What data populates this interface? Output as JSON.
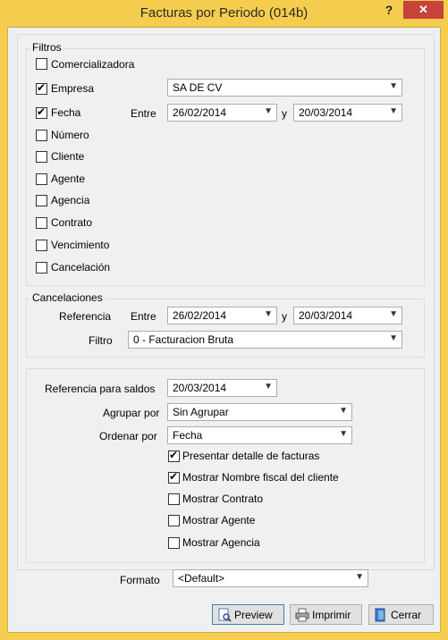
{
  "window": {
    "title": "Facturas por Periodo (014b)",
    "help_glyph": "?",
    "close_glyph": "✕"
  },
  "filtros": {
    "legend": "Filtros",
    "items": [
      {
        "label": "Comercializadora",
        "checked": false
      },
      {
        "label": "Empresa",
        "checked": true
      },
      {
        "label": "Fecha",
        "checked": true
      },
      {
        "label": "Número",
        "checked": false
      },
      {
        "label": "Cliente",
        "checked": false
      },
      {
        "label": "Agente",
        "checked": false
      },
      {
        "label": "Agencia",
        "checked": false
      },
      {
        "label": "Contrato",
        "checked": false
      },
      {
        "label": "Vencimiento",
        "checked": false
      },
      {
        "label": "Cancelación",
        "checked": false
      }
    ],
    "empresa_value": "SA DE CV",
    "entre_label": "Entre",
    "y_label": "y",
    "fecha_desde": "26/02/2014",
    "fecha_hasta": "20/03/2014"
  },
  "cancelaciones": {
    "legend": "Cancelaciones",
    "referencia_label": "Referencia",
    "entre_label": "Entre",
    "y_label": "y",
    "fecha_desde": "26/02/2014",
    "fecha_hasta": "20/03/2014",
    "filtro_label": "Filtro",
    "filtro_value": "0 - Facturacion Bruta"
  },
  "opciones": {
    "referencia_saldos_label": "Referencia para saldos",
    "referencia_saldos_value": "20/03/2014",
    "agrupar_label": "Agrupar por",
    "agrupar_value": "Sin Agrupar",
    "ordenar_label": "Ordenar por",
    "ordenar_value": "Fecha",
    "checks": [
      {
        "label": "Presentar detalle de facturas",
        "checked": true
      },
      {
        "label": "Mostrar Nombre fiscal del cliente",
        "checked": true
      },
      {
        "label": "Mostrar Contrato",
        "checked": false
      },
      {
        "label": "Mostrar Agente",
        "checked": false
      },
      {
        "label": "Mostrar Agencia",
        "checked": false
      }
    ]
  },
  "formato": {
    "label": "Formato",
    "value": "<Default>"
  },
  "buttons": {
    "preview": "Preview",
    "imprimir": "Imprimir",
    "cerrar": "Cerrar"
  }
}
